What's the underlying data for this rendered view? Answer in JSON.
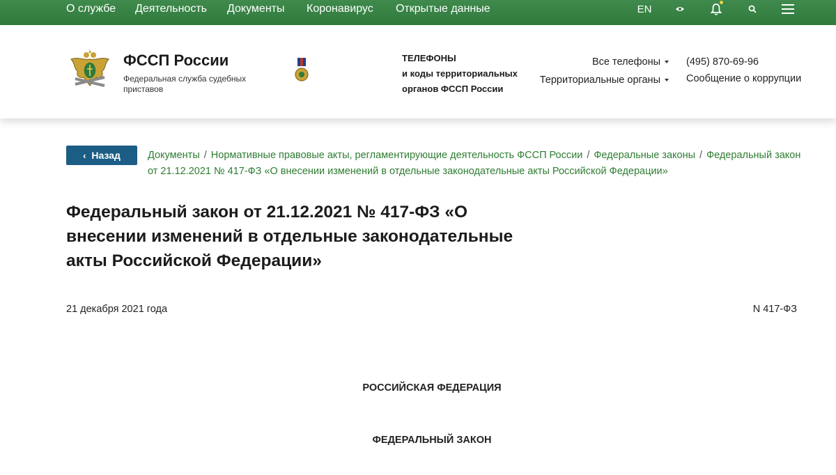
{
  "topnav": {
    "items": [
      "О службе",
      "Деятельность",
      "Документы",
      "Коронавирус",
      "Открытые данные"
    ],
    "lang": "EN",
    "icons": [
      "eye-icon",
      "bell-icon",
      "search-icon",
      "menu-icon"
    ]
  },
  "header": {
    "title": "ФССП России",
    "subtitle": "Федеральная служба судебных приставов",
    "phones_title_line1": "ТЕЛЕФОНЫ",
    "phones_title_line2": "и коды территориальных",
    "phones_title_line3": "органов ФССП России",
    "all_phones": "Все телефоны",
    "territorial": "Территориальные органы",
    "phone": "(495) 870-69-96",
    "corruption": "Сообщение о коррупции"
  },
  "back_label": "Назад",
  "breadcrumb": [
    "Документы",
    "Нормативные правовые акты, регламентирующие деятельность ФССП России",
    "Федеральные законы",
    "Федеральный закон от 21.12.2021 № 417-ФЗ «О внесении изменений в отдельные законодательные акты Российской Федерации»"
  ],
  "title": "Федеральный закон от 21.12.2021 № 417-ФЗ «О внесении изменений в отдельные законодательные акты Российской Федерации»",
  "document": {
    "date": "21 декабря 2021 года",
    "number": "N 417-ФЗ",
    "heading1": "РОССИЙСКАЯ ФЕДЕРАЦИЯ",
    "heading2": "ФЕДЕРАЛЬНЫЙ ЗАКОН"
  },
  "colors": {
    "nav_green": "#2f7a3c",
    "link_green": "#2e7d32",
    "back_button": "#1c5d86",
    "notification_dot": "#e8d64a"
  }
}
